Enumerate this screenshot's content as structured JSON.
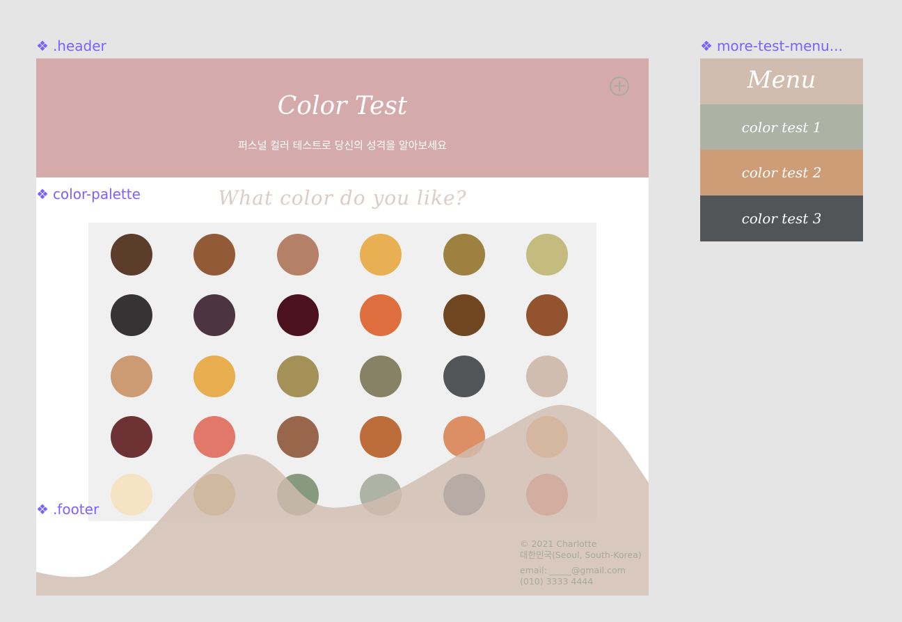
{
  "labels": {
    "header": ".header",
    "palette": "color-palette",
    "footer": ".footer",
    "menu": "more-test-menu..."
  },
  "header": {
    "title": "Color Test",
    "subtitle": "퍼스널 컬러 테스트로 당신의 성격을 알아보세요",
    "add_icon": "plus-circle-icon"
  },
  "question": "What color do you like?",
  "palette": {
    "rows": [
      [
        "#5c3d2c",
        "#935a38",
        "#b58068",
        "#e8b052",
        "#9c8140",
        "#c4bb7f"
      ],
      [
        "#363334",
        "#4c3441",
        "#4b111e",
        "#df6e3e",
        "#704620",
        "#93532e"
      ],
      [
        "#cc9b73",
        "#e8ad4e",
        "#a39158",
        "#878265",
        "#515557",
        "#d1bcb0"
      ],
      [
        "#6e3234",
        "#e2786a",
        "#98664b",
        "#bc6c38",
        "#dd8e64",
        "#e69a55"
      ],
      [
        "#f6e3c3",
        "#cbae5d",
        "#889a7e",
        "#afb3a5",
        "#3c6773",
        "#df6956"
      ]
    ]
  },
  "footer": {
    "copyright": "© 2021 Charlotte",
    "location": "대한민국(Seoul, South-Korea)",
    "email": "email: _____@gmail.com",
    "phone": "(010) 3333 4444"
  },
  "menu": {
    "title": "Menu",
    "items": [
      "color test 1",
      "color test 2",
      "color test 3"
    ]
  },
  "colors": {
    "header_bg": "#d4aaaa",
    "footer_wave": "#d1bcb0",
    "label_accent": "#7b61ff"
  }
}
